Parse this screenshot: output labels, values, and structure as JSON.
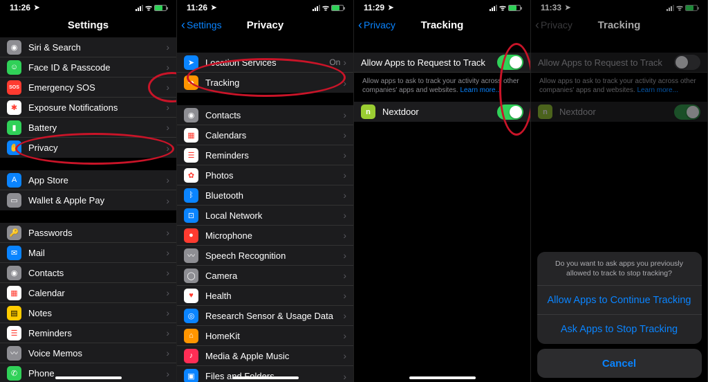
{
  "p1": {
    "time": "11:26",
    "title": "Settings",
    "g1": [
      {
        "label": "Siri & Search",
        "icon": "siri",
        "bg": "ic-gray"
      },
      {
        "label": "Face ID & Passcode",
        "icon": "faceid",
        "bg": "ic-green"
      },
      {
        "label": "Emergency SOS",
        "icon": "sos",
        "bg": "ic-red",
        "txt": "SOS"
      },
      {
        "label": "Exposure Notifications",
        "icon": "exposure",
        "bg": "ic-white"
      },
      {
        "label": "Battery",
        "icon": "battery",
        "bg": "ic-green"
      },
      {
        "label": "Privacy",
        "icon": "privacy",
        "bg": "ic-blue"
      }
    ],
    "g2": [
      {
        "label": "App Store",
        "icon": "appstore",
        "bg": "ic-blue"
      },
      {
        "label": "Wallet & Apple Pay",
        "icon": "wallet",
        "bg": "ic-gray"
      }
    ],
    "g3": [
      {
        "label": "Passwords",
        "icon": "passwords",
        "bg": "ic-gray"
      },
      {
        "label": "Mail",
        "icon": "mail",
        "bg": "ic-blue"
      },
      {
        "label": "Contacts",
        "icon": "contacts",
        "bg": "ic-gray"
      },
      {
        "label": "Calendar",
        "icon": "calendar",
        "bg": "ic-white"
      },
      {
        "label": "Notes",
        "icon": "notes",
        "bg": "ic-yellow"
      },
      {
        "label": "Reminders",
        "icon": "reminders",
        "bg": "ic-white"
      },
      {
        "label": "Voice Memos",
        "icon": "voice",
        "bg": "ic-gray"
      },
      {
        "label": "Phone",
        "icon": "phone",
        "bg": "ic-green"
      }
    ]
  },
  "p2": {
    "time": "11:26",
    "back": "Settings",
    "title": "Privacy",
    "g1": [
      {
        "label": "Location Services",
        "icon": "location",
        "bg": "ic-blue",
        "detail": "On"
      },
      {
        "label": "Tracking",
        "icon": "tracking",
        "bg": "ic-orange"
      }
    ],
    "g2": [
      {
        "label": "Contacts",
        "icon": "contacts",
        "bg": "ic-gray"
      },
      {
        "label": "Calendars",
        "icon": "calendars",
        "bg": "ic-white"
      },
      {
        "label": "Reminders",
        "icon": "reminders",
        "bg": "ic-white"
      },
      {
        "label": "Photos",
        "icon": "photos",
        "bg": "ic-white"
      },
      {
        "label": "Bluetooth",
        "icon": "bluetooth",
        "bg": "ic-blue"
      },
      {
        "label": "Local Network",
        "icon": "network",
        "bg": "ic-blue"
      },
      {
        "label": "Microphone",
        "icon": "mic",
        "bg": "ic-red"
      },
      {
        "label": "Speech Recognition",
        "icon": "speech",
        "bg": "ic-gray"
      },
      {
        "label": "Camera",
        "icon": "camera",
        "bg": "ic-gray"
      },
      {
        "label": "Health",
        "icon": "health",
        "bg": "ic-white"
      },
      {
        "label": "Research Sensor & Usage Data",
        "icon": "research",
        "bg": "ic-blue"
      },
      {
        "label": "HomeKit",
        "icon": "homekit",
        "bg": "ic-orange"
      },
      {
        "label": "Media & Apple Music",
        "icon": "music",
        "bg": "ic-pink"
      },
      {
        "label": "Files and Folders",
        "icon": "files",
        "bg": "ic-blue"
      }
    ]
  },
  "p3": {
    "time": "11:29",
    "back": "Privacy",
    "title": "Tracking",
    "allow_label": "Allow Apps to Request to Track",
    "allow_on": true,
    "note": "Allow apps to ask to track your activity across other companies' apps and websites. ",
    "learn": "Learn more...",
    "apps": [
      {
        "label": "Nextdoor",
        "bg": "ic-nd",
        "on": true
      }
    ]
  },
  "p4": {
    "time": "11:33",
    "back": "Privacy",
    "title": "Tracking",
    "allow_label": "Allow Apps to Request to Track",
    "allow_on": false,
    "note": "Allow apps to ask to track your activity across other companies' apps and websites. ",
    "learn": "Learn more...",
    "apps": [
      {
        "label": "Nextdoor",
        "bg": "ic-nd",
        "on": true
      }
    ],
    "sheet": {
      "msg": "Do you want to ask apps you previously allowed to track to stop tracking?",
      "opt1": "Allow Apps to Continue Tracking",
      "opt2": "Ask Apps to Stop Tracking",
      "cancel": "Cancel"
    }
  }
}
